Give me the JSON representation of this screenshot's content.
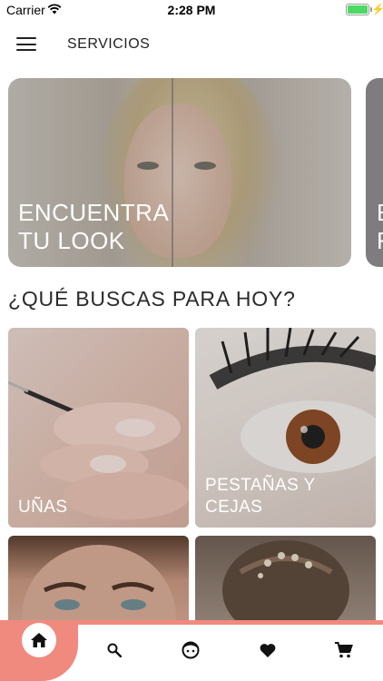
{
  "status_bar": {
    "carrier": "Carrier",
    "time": "2:28 PM",
    "battery_level": 1.0,
    "battery_color": "#4cd964"
  },
  "header": {
    "title": "SERVICIOS",
    "menu_icon": "hamburger-icon"
  },
  "hero": {
    "title": "ENCUENTRA TU LOOK",
    "next_title_partial": "E\nF"
  },
  "section": {
    "title": "¿QUÉ BUSCAS PARA HOY?"
  },
  "categories": [
    {
      "label": "UÑAS"
    },
    {
      "label": "PESTAÑAS Y CEJAS"
    },
    {
      "label": ""
    },
    {
      "label": ""
    }
  ],
  "bottom_nav": {
    "accent_color": "#f08a7e",
    "items": [
      {
        "icon": "home-icon",
        "active": true
      },
      {
        "icon": "search-icon",
        "active": false
      },
      {
        "icon": "face-icon",
        "active": false
      },
      {
        "icon": "heart-icon",
        "active": false
      },
      {
        "icon": "cart-icon",
        "active": false
      }
    ]
  }
}
